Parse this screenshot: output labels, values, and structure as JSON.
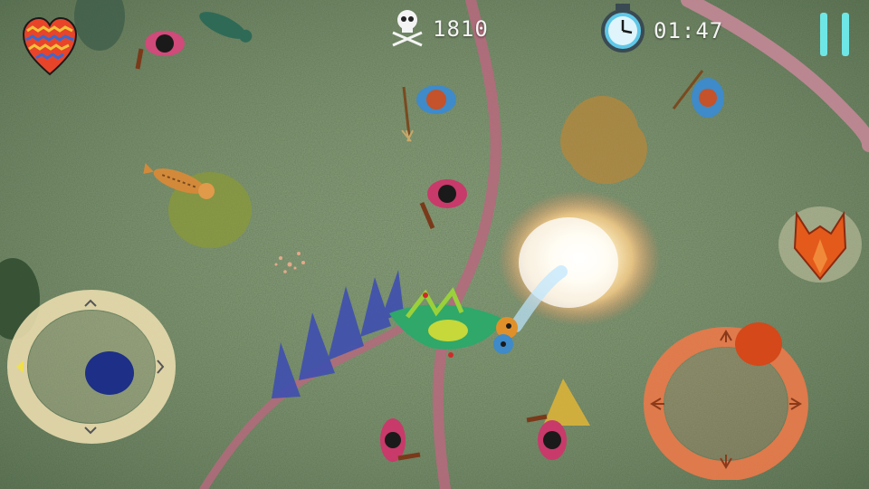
{
  "hud": {
    "lives_icon": "patterned-heart-icon",
    "kills_icon": "skull-crossbones-icon",
    "kill_count": "1810",
    "timer_icon": "stopwatch-icon",
    "timer": "01:47",
    "pause_icon": "pause-icon"
  },
  "controls": {
    "move_joystick": {
      "arrow_icons": [
        "chevron-up-icon",
        "chevron-right-icon",
        "chevron-down-icon",
        "chevron-left-icon"
      ],
      "ring_color": "#e9dcae",
      "knob_color": "#1d2f86"
    },
    "fire_joystick": {
      "arrow_icons": [
        "claw-up-icon",
        "claw-right-icon",
        "claw-down-icon",
        "claw-left-icon"
      ],
      "ring_color": "#e8794a",
      "knob_color": "#d4481a"
    },
    "special_button_icon": "fox-head-icon"
  },
  "world": {
    "player": "dragon",
    "enemies": [
      "villager",
      "villager",
      "villager",
      "villager",
      "villager",
      "villager",
      "villager"
    ],
    "animals": [
      "fox",
      "lizard",
      "bird"
    ],
    "effects": [
      "fire-breath",
      "sparkle"
    ],
    "colors": {
      "grass": "#5f7a52",
      "path": "#b46a7c",
      "fire": "#fff3c4"
    }
  }
}
